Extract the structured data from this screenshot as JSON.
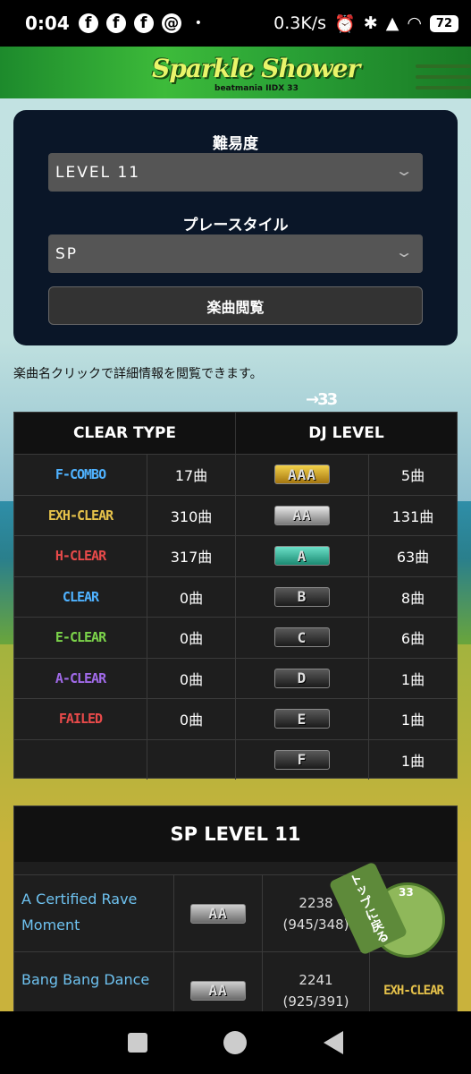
{
  "status_bar": {
    "time": "0:04",
    "fb": "f",
    "dot": "•",
    "net_speed": "0.3K/s",
    "alarm_icon": "⏰",
    "bt_icon": "✱",
    "signal_icon": "▲",
    "wifi_icon": "◠",
    "battery": "72"
  },
  "header": {
    "logo": "Sparkle Shower",
    "logo_sub": "beatmania IIDX 33"
  },
  "filter": {
    "difficulty_label": "難易度",
    "difficulty_value": "LEVEL 11",
    "style_label": "プレースタイル",
    "style_value": "SP",
    "chevron": "❯",
    "browse_button": "楽曲閲覧"
  },
  "note": "楽曲名クリックで詳細情報を閲覧できます。",
  "arrow_deco": "→33",
  "stats": {
    "clear_header": "CLEAR TYPE",
    "dj_header": "DJ LEVEL",
    "rows": [
      {
        "clear": "F-COMBO",
        "clear_color": "#4fb2ff",
        "clear_count": "17曲",
        "dj": "AAA",
        "dj_bg": "gold",
        "dj_count": "5曲"
      },
      {
        "clear": "EXH-CLEAR",
        "clear_color": "#e6c24a",
        "clear_count": "310曲",
        "dj": "AA",
        "dj_bg": "silver",
        "dj_count": "131曲"
      },
      {
        "clear": "H-CLEAR",
        "clear_color": "#e84a4a",
        "clear_count": "317曲",
        "dj": "A",
        "dj_bg": "teal",
        "dj_count": "63曲"
      },
      {
        "clear": "CLEAR",
        "clear_color": "#4fb2ff",
        "clear_count": "0曲",
        "dj": "B",
        "dj_bg": "dark",
        "dj_count": "8曲"
      },
      {
        "clear": "E-CLEAR",
        "clear_color": "#7bd34a",
        "clear_count": "0曲",
        "dj": "C",
        "dj_bg": "dark",
        "dj_count": "6曲"
      },
      {
        "clear": "A-CLEAR",
        "clear_color": "#a06ae8",
        "clear_count": "0曲",
        "dj": "D",
        "dj_bg": "dark",
        "dj_count": "1曲"
      },
      {
        "clear": "FAILED",
        "clear_color": "#e84a4a",
        "clear_count": "0曲",
        "dj": "E",
        "dj_bg": "dark",
        "dj_count": "1曲"
      },
      {
        "clear": "",
        "clear_color": "#fff",
        "clear_count": "",
        "dj": "F",
        "dj_bg": "dark",
        "dj_count": "1曲"
      }
    ]
  },
  "songs": {
    "title": "SP LEVEL 11",
    "items": [
      {
        "name": "A Certified Rave Moment",
        "dj": "AA",
        "score": "2238",
        "detail": "(945/348)",
        "clear": ""
      },
      {
        "name": "Bang Bang Dance",
        "dj": "AA",
        "score": "2241",
        "detail": "(925/391)",
        "clear": "EXH-CLEAR"
      }
    ]
  },
  "totop_label": "トップに戻る",
  "totop_badge": "33"
}
